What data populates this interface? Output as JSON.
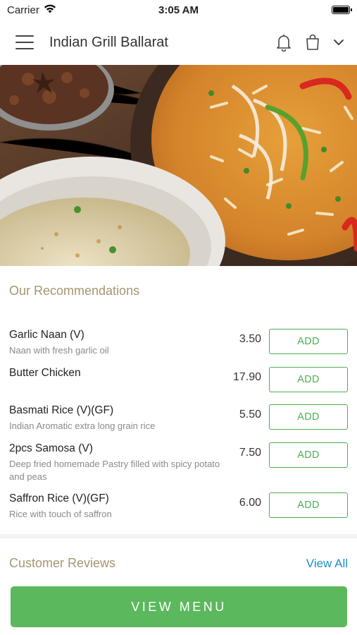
{
  "status_bar": {
    "carrier": "Carrier",
    "time": "3:05 AM"
  },
  "header": {
    "title": "Indian Grill Ballarat",
    "icons": [
      "menu-icon",
      "bell-icon",
      "shopping-bag-icon",
      "chevron-down-icon"
    ]
  },
  "recommendations": {
    "title": "Our Recommendations",
    "items": [
      {
        "name": "Garlic Naan (V)",
        "description": "Naan with fresh garlic oil",
        "price": "3.50",
        "button": "ADD"
      },
      {
        "name": "Butter Chicken",
        "description": "",
        "price": "17.90",
        "button": "ADD"
      },
      {
        "name": "Basmati Rice (V)(GF)",
        "description": "Indian Aromatic extra long grain rice",
        "price": "5.50",
        "button": "ADD"
      },
      {
        "name": "2pcs Samosa (V)",
        "description": "Deep fried homemade Pastry filled with spicy potato and peas",
        "price": "7.50",
        "button": "ADD"
      },
      {
        "name": "Saffron Rice (V)(GF)",
        "description": "Rice with touch of saffron",
        "price": "6.00",
        "button": "ADD"
      }
    ]
  },
  "reviews": {
    "title": "Customer Reviews",
    "view_all": "View All"
  },
  "footer": {
    "view_menu": "VIEW MENU"
  },
  "colors": {
    "accent_green": "#5cb85c",
    "section_title": "#a69570",
    "link_blue": "#1a8fc9"
  }
}
